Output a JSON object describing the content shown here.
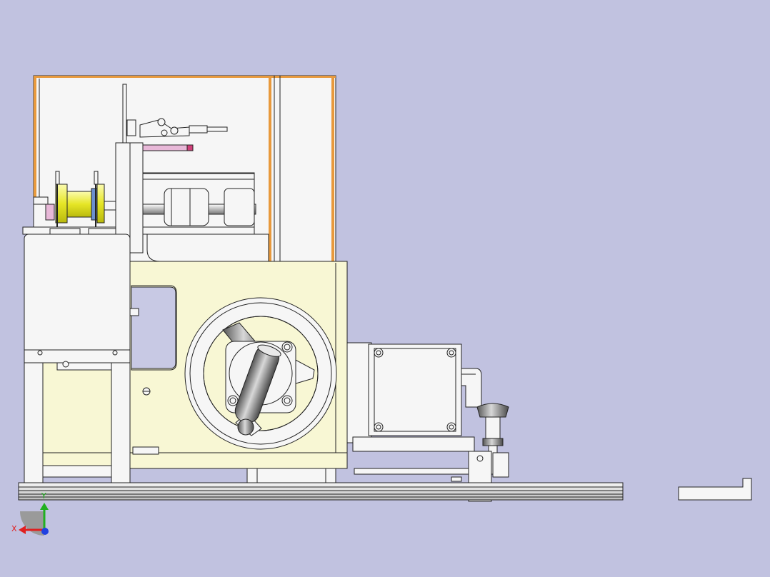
{
  "viewport": {
    "background": "#c1c2e0",
    "outline_color": "#222222"
  },
  "colors": {
    "frame_panel": "#f6f6f6",
    "cream_body": "#f8f7d4",
    "orange_edge": "#e8993c",
    "yellow_roll": "#eeee40",
    "blue_ring": "#6b8fd0",
    "pink_plate": "#e8b8d8",
    "metal_dark": "#6a6a6a",
    "metal_mid": "#a8a8a8",
    "rail_light": "#eaeaea"
  },
  "orientation_triad": {
    "x_label": "X",
    "y_label": "Y",
    "x_color": "#e02020",
    "y_color": "#20b020",
    "z_color": "#2040e0"
  },
  "model": {
    "components": [
      "guard-enclosure",
      "toggle-clamp",
      "spool-unwinder",
      "feed-cylinder",
      "side-frame",
      "machine-base",
      "handwheel",
      "gear-motor",
      "adjustment-knob",
      "base-rail",
      "end-stop-bracket"
    ]
  }
}
